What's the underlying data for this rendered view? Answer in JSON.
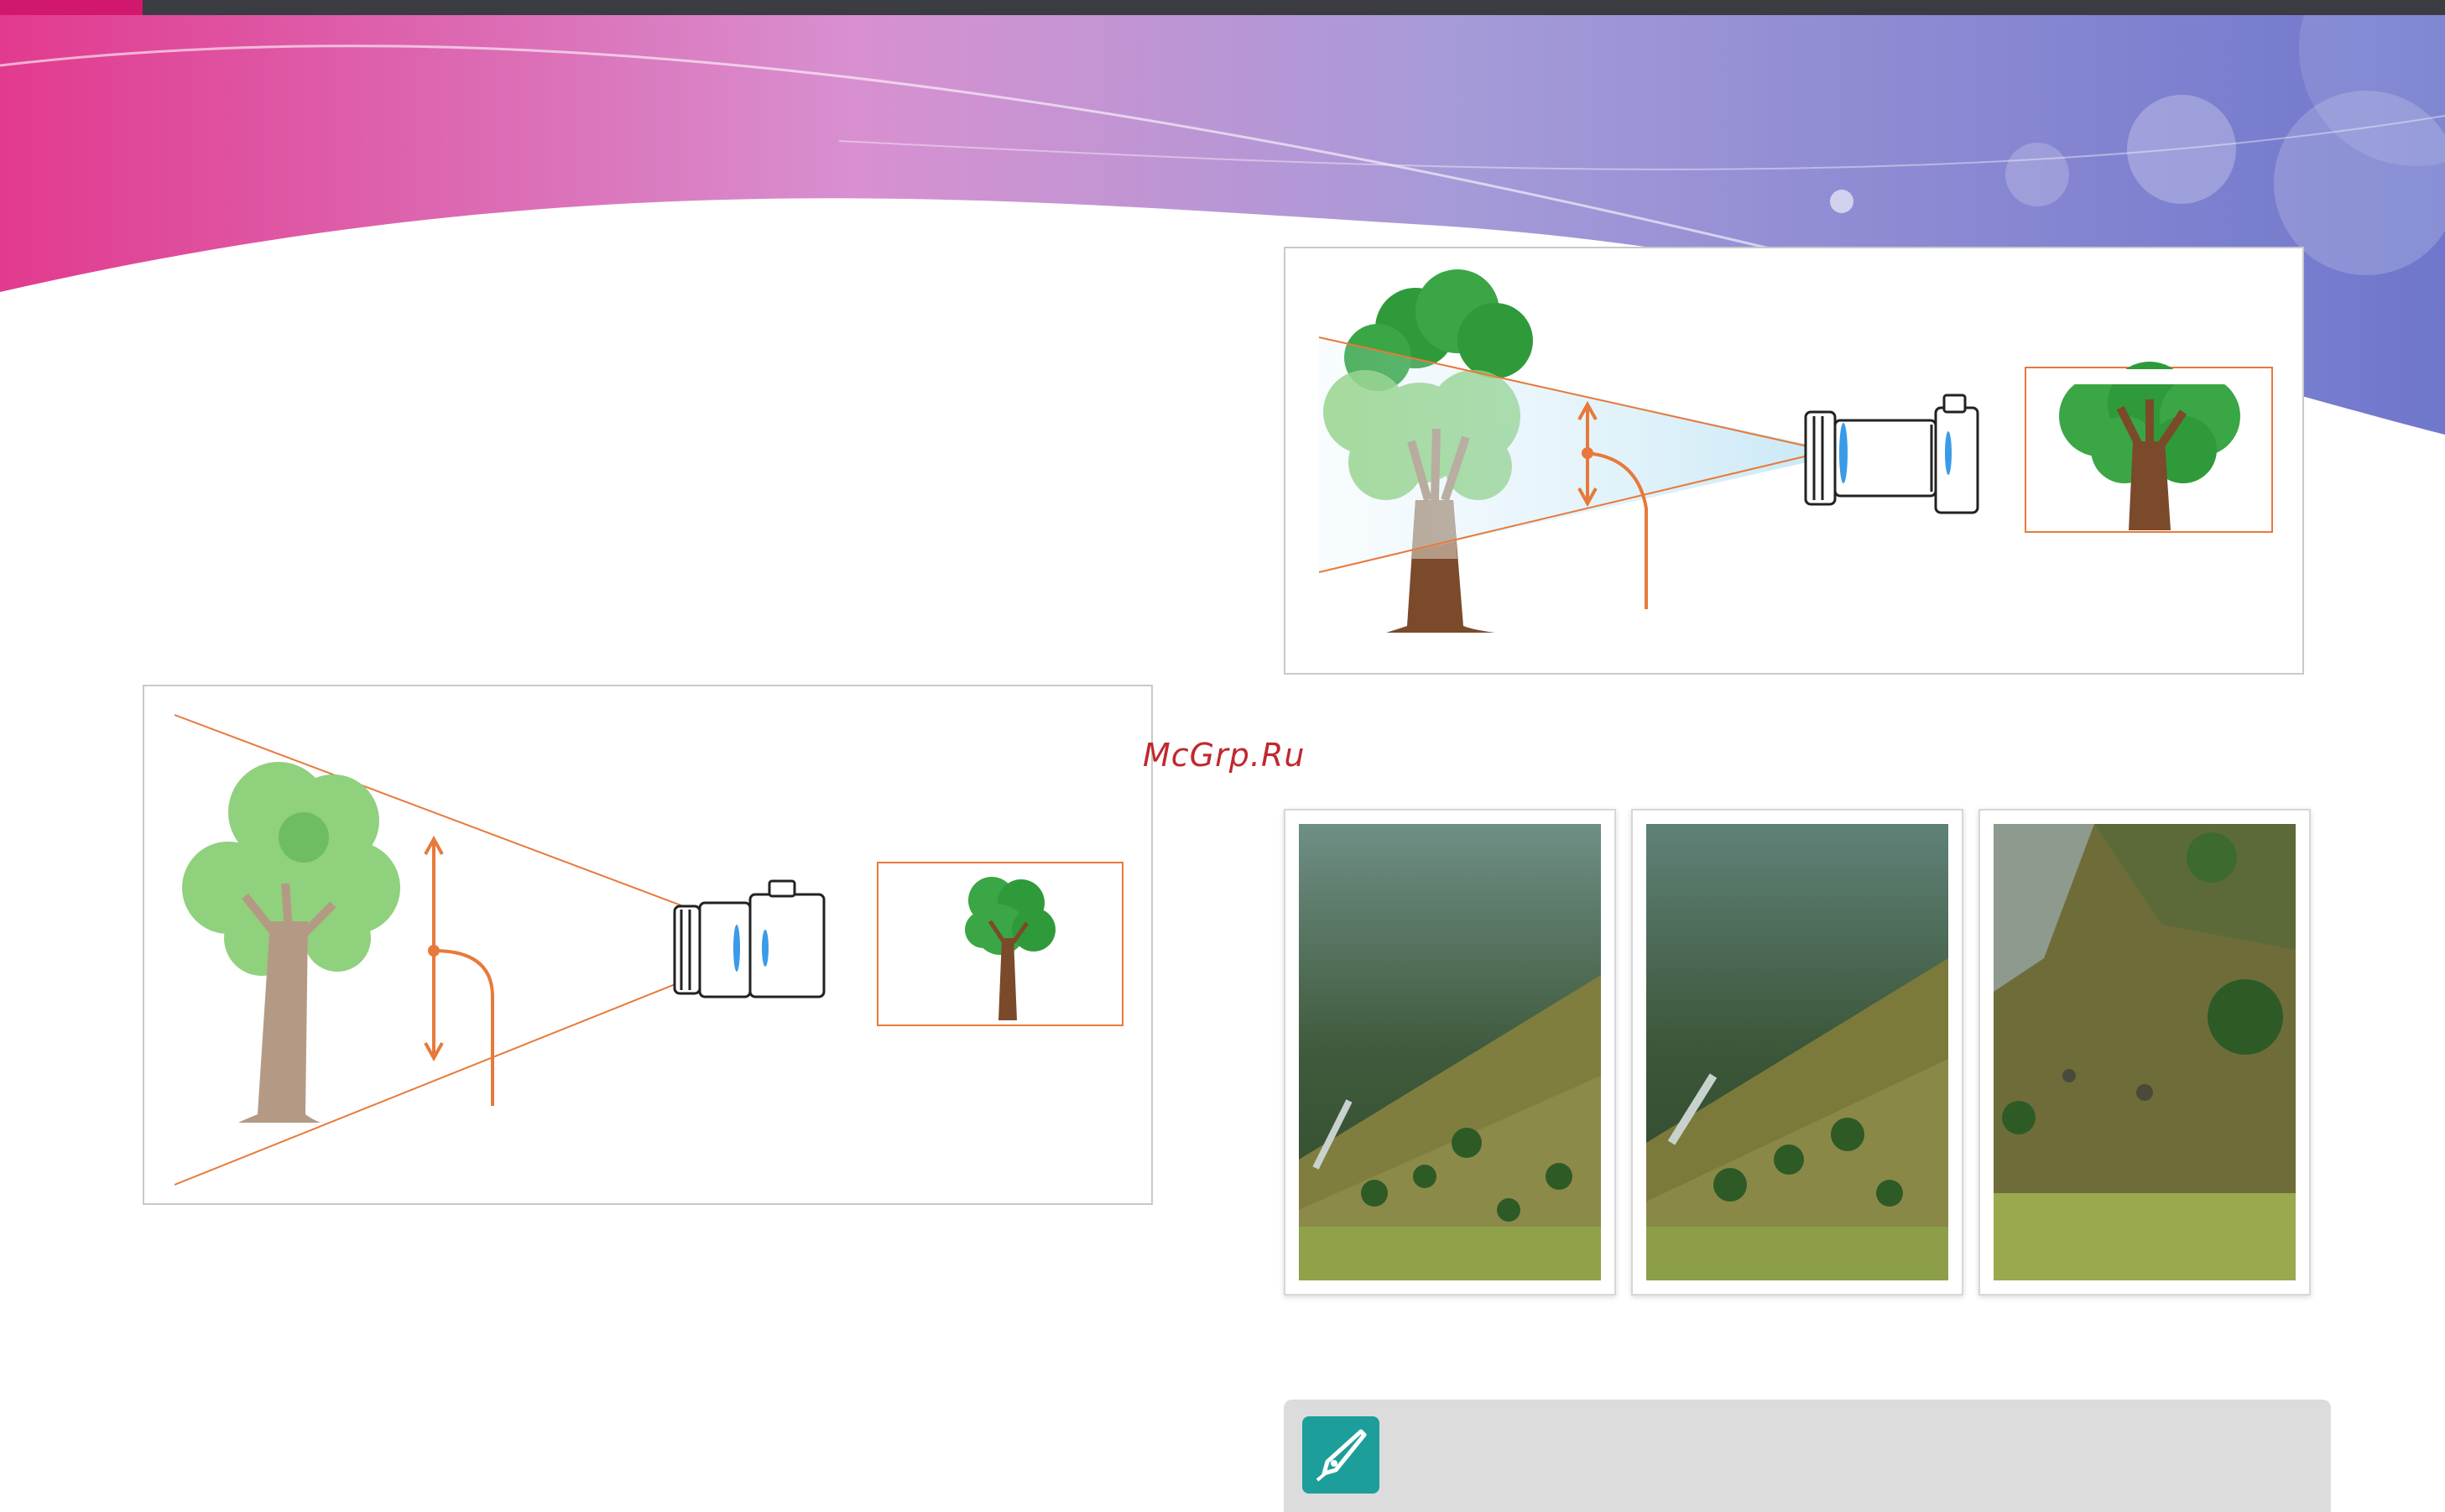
{
  "watermark": "McGrp.Ru",
  "colors": {
    "topbar": "#3b3b42",
    "accent": "#d2186e",
    "orange_line": "#e8793a",
    "note_bg": "#dcdcdc",
    "note_icon": "#1c9e9a"
  },
  "icons": {
    "note": "pen-nib-icon"
  }
}
